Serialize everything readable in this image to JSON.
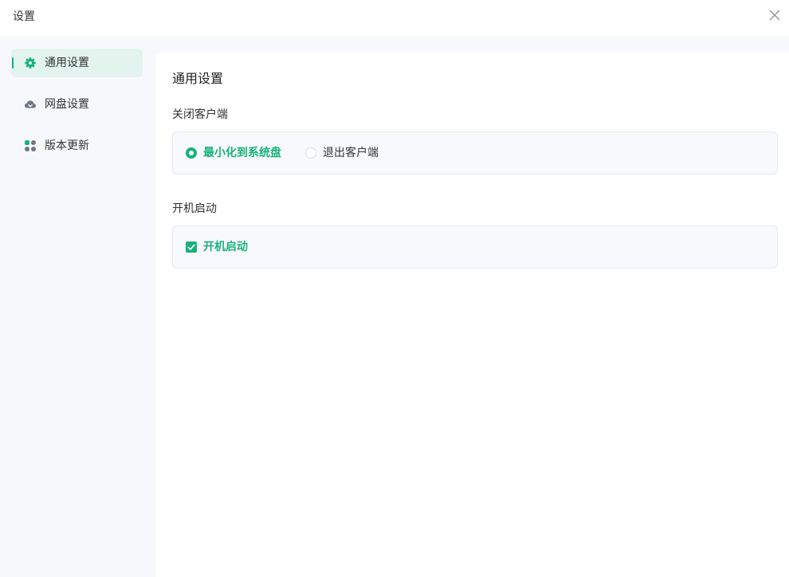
{
  "window": {
    "title": "设置"
  },
  "sidebar": {
    "items": [
      {
        "label": "通用设置",
        "icon": "gear-icon",
        "active": true
      },
      {
        "label": "网盘设置",
        "icon": "cloud-icon",
        "active": false
      },
      {
        "label": "版本更新",
        "icon": "grid-icon",
        "active": false
      }
    ]
  },
  "main": {
    "title": "通用设置",
    "close_client": {
      "label": "关闭客户端",
      "options": [
        {
          "label": "最小化到系统盘",
          "selected": true
        },
        {
          "label": "退出客户端",
          "selected": false
        }
      ]
    },
    "startup": {
      "label": "开机启动",
      "checkbox_label": "开机启动",
      "checked": true
    }
  },
  "colors": {
    "accent": "#19b27a",
    "sidebar_bg": "#f7f8fc",
    "active_bg": "#e3f4ef",
    "icon_gray": "#6e7583"
  }
}
